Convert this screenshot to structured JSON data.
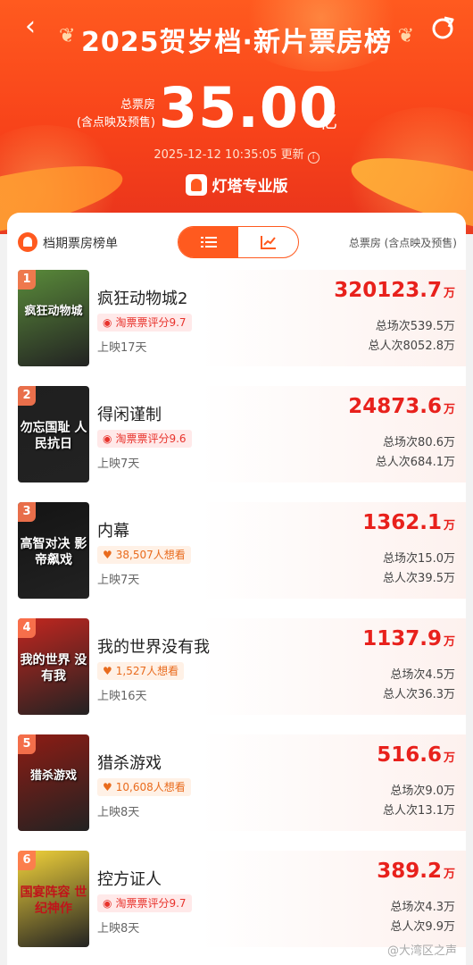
{
  "header": {
    "title": "2025贺岁档·新片票房榜",
    "total_label_line1": "总票房",
    "total_label_line2": "(含点映及预售)",
    "total_value": "35.00",
    "total_unit": "亿",
    "updated_time": "2025-12-12 10:35:05",
    "updated_suffix": "更新",
    "brand": "灯塔专业版"
  },
  "panel": {
    "title": "档期票房榜单",
    "right_label": "总票房 (含点映及预售)",
    "toggle": [
      "list-icon",
      "chart-icon"
    ],
    "active_toggle": 0
  },
  "movies": [
    {
      "rank": "1",
      "name": "疯狂动物城2",
      "tag_type": "score",
      "tag": "淘票票评分9.7",
      "days": "上映17天",
      "box": "320123.7",
      "unit": "万",
      "shows": "总场次539.5万",
      "audience": "总人次8052.8万",
      "poster_color": "#5a8b3a",
      "poster_text": "疯狂动物城"
    },
    {
      "rank": "2",
      "name": "得闲谨制",
      "tag_type": "score",
      "tag": "淘票票评分9.6",
      "days": "上映7天",
      "box": "24873.6",
      "unit": "万",
      "shows": "总场次80.6万",
      "audience": "总人次684.1万",
      "poster_color": "#1f1f1f",
      "poster_text": "勿忘国耻 人民抗日"
    },
    {
      "rank": "3",
      "name": "内幕",
      "tag_type": "want",
      "tag": "38,507人想看",
      "days": "上映7天",
      "box": "1362.1",
      "unit": "万",
      "shows": "总场次15.0万",
      "audience": "总人次39.5万",
      "poster_color": "#141414",
      "poster_text": "高智对决 影帝飙戏"
    },
    {
      "rank": "4",
      "name": "我的世界没有我",
      "tag_type": "want",
      "tag": "1,527人想看",
      "days": "上映16天",
      "box": "1137.9",
      "unit": "万",
      "shows": "总场次4.5万",
      "audience": "总人次36.3万",
      "poster_color": "#c2261f",
      "poster_text": "我的世界 没有我"
    },
    {
      "rank": "5",
      "name": "猎杀游戏",
      "tag_type": "want",
      "tag": "10,608人想看",
      "days": "上映8天",
      "box": "516.6",
      "unit": "万",
      "shows": "总场次9.0万",
      "audience": "总人次13.1万",
      "poster_color": "#8e1c14",
      "poster_text": "猎杀游戏"
    },
    {
      "rank": "6",
      "name": "控方证人",
      "tag_type": "score",
      "tag": "淘票票评分9.7",
      "days": "上映8天",
      "box": "389.2",
      "unit": "万",
      "shows": "总场次4.3万",
      "audience": "总人次9.9万",
      "poster_color": "#f1d23a",
      "poster_text": "国宴阵容 世纪神作"
    }
  ],
  "watermark": "@大湾区之声"
}
